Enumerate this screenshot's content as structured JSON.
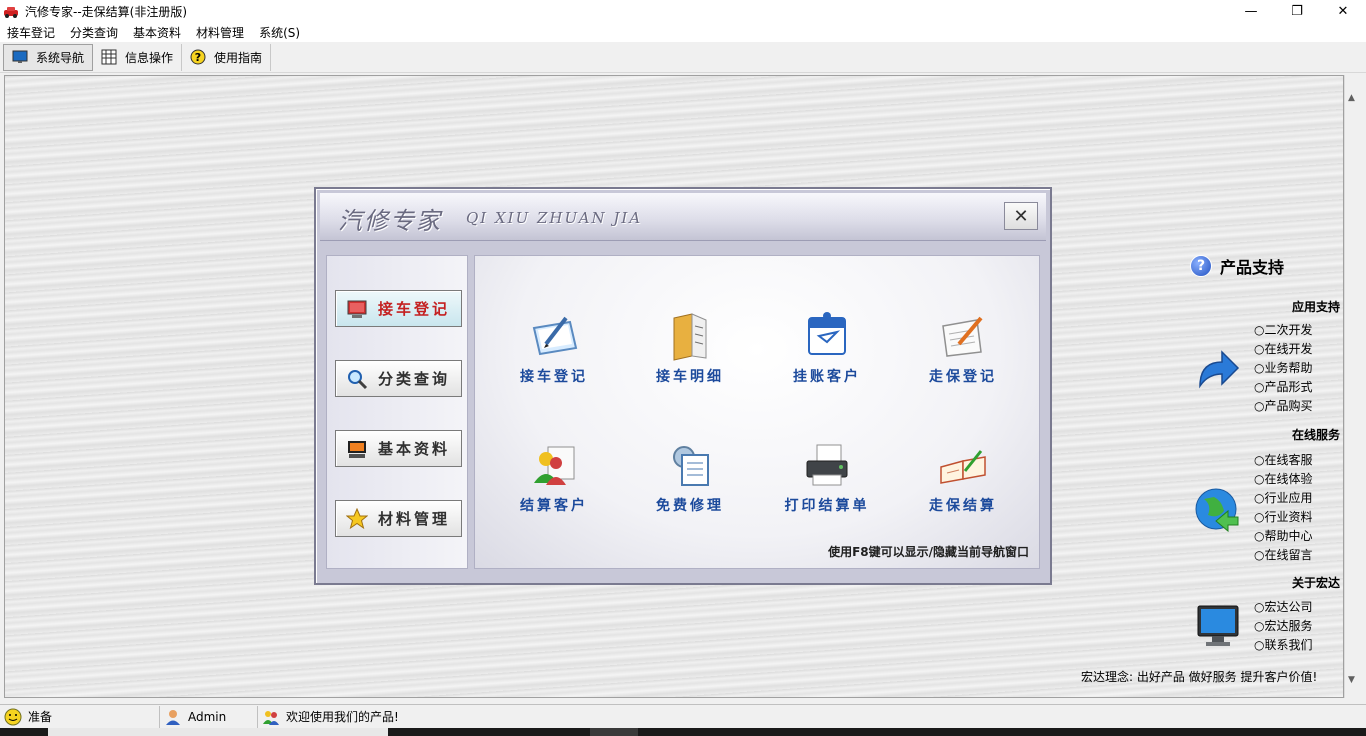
{
  "window": {
    "title": "汽修专家--走保结算(非注册版)",
    "controls": {
      "minimize": "—",
      "maximize": "❐",
      "close": "✕"
    }
  },
  "menubar": [
    {
      "label": "接车登记"
    },
    {
      "label": "分类查询"
    },
    {
      "label": "基本资料"
    },
    {
      "label": "材料管理"
    },
    {
      "label": "系统(S)"
    }
  ],
  "toolbar": [
    {
      "label": "系统导航",
      "icon": "monitor-icon",
      "active": true
    },
    {
      "label": "信息操作",
      "icon": "grid-icon",
      "active": false
    },
    {
      "label": "使用指南",
      "icon": "help-icon",
      "active": false
    }
  ],
  "nav_dialog": {
    "title_cn": "汽修专家",
    "title_en": "QI XIU ZHUAN JIA",
    "close": "✕",
    "side_buttons": [
      {
        "label": "接车登记",
        "icon": "monitor-red-icon",
        "active": true
      },
      {
        "label": "分类查询",
        "icon": "magnifier-icon",
        "active": false
      },
      {
        "label": "基本资料",
        "icon": "computer-icon",
        "active": false
      },
      {
        "label": "材料管理",
        "icon": "star-icon",
        "active": false
      }
    ],
    "tiles": [
      {
        "label": "接车登记",
        "icon": "pen-pad-icon"
      },
      {
        "label": "接车明细",
        "icon": "binder-icon"
      },
      {
        "label": "挂账客户",
        "icon": "calendar-icon"
      },
      {
        "label": "走保登记",
        "icon": "note-pencil-icon"
      },
      {
        "label": "结算客户",
        "icon": "users-doc-icon"
      },
      {
        "label": "免费修理",
        "icon": "gear-doc-icon"
      },
      {
        "label": "打印结算单",
        "icon": "printer-icon"
      },
      {
        "label": "走保结算",
        "icon": "open-book-icon"
      }
    ],
    "hint": "使用F8键可以显示/隐藏当前导航窗口"
  },
  "support": {
    "heading": "产品支持",
    "sections": [
      {
        "title": "应用支持",
        "icon": "arrow-icon",
        "links": [
          "○二次开发",
          "○在线开发",
          "○业务帮助",
          "○产品形式",
          "○产品购买"
        ]
      },
      {
        "title": "在线服务",
        "icon": "globe-icon",
        "links": [
          "○在线客服",
          "○在线体验",
          "○行业应用",
          "○行业资料",
          "○帮助中心",
          "○在线留言"
        ]
      },
      {
        "title": "关于宏达",
        "icon": "monitor-icon",
        "links": [
          "○宏达公司",
          "○宏达服务",
          "○联系我们"
        ]
      }
    ],
    "slogan": "宏达理念: 出好产品  做好服务  提升客户价值!"
  },
  "statusbar": {
    "status": "准备",
    "user": "Admin",
    "message": "欢迎使用我们的产品!"
  }
}
